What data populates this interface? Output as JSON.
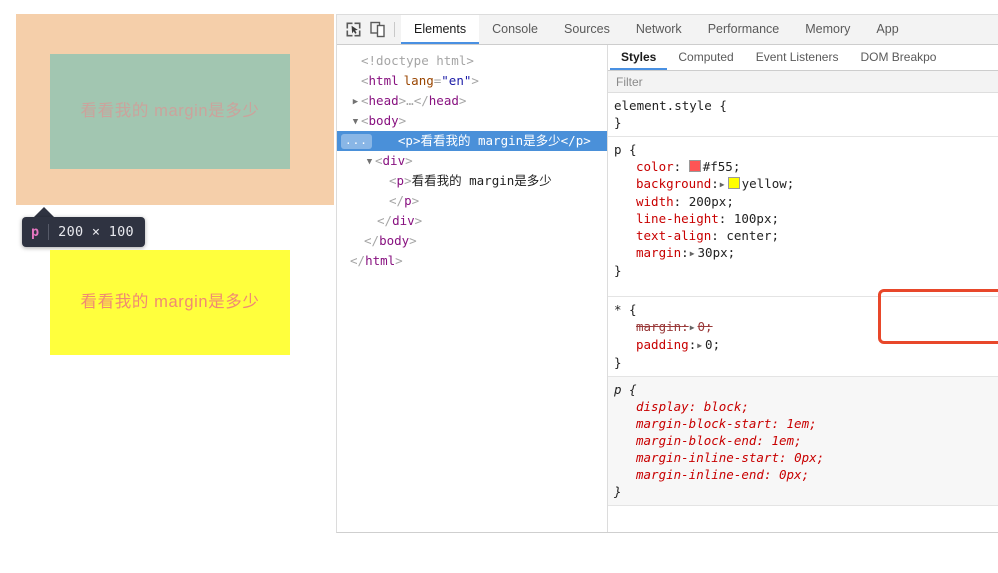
{
  "viewport": {
    "paragraph_text": "看看我的 margin是多少",
    "colors": {
      "margin_highlight": "#f5cfaa",
      "content_highlight": "#a2c6b1",
      "paragraph_background": "#ffff3d",
      "paragraph_color": "#f08a72"
    },
    "node_tooltip": {
      "tag": "p",
      "dimensions": "200 × 100"
    }
  },
  "devtools": {
    "toolbar_icons": [
      {
        "name": "inspect-element-icon"
      },
      {
        "name": "device-toolbar-icon"
      }
    ],
    "tabs": [
      {
        "label": "Elements",
        "active": true
      },
      {
        "label": "Console",
        "active": false
      },
      {
        "label": "Sources",
        "active": false
      },
      {
        "label": "Network",
        "active": false
      },
      {
        "label": "Performance",
        "active": false
      },
      {
        "label": "Memory",
        "active": false
      },
      {
        "label": "App",
        "active": false
      }
    ],
    "dom_tree": [
      {
        "indent": 0,
        "twisty": "",
        "html": "doctype",
        "selected": false
      },
      {
        "indent": 0,
        "twisty": "",
        "html": "html_open",
        "selected": false
      },
      {
        "indent": 0,
        "twisty": "▶",
        "html": "head",
        "selected": false
      },
      {
        "indent": 0,
        "twisty": "▼",
        "html": "body_open",
        "selected": false
      },
      {
        "indent": 1,
        "twisty": "",
        "html": "p_selected",
        "selected": true
      },
      {
        "indent": 1,
        "twisty": "▼",
        "html": "div_open",
        "selected": false
      },
      {
        "indent": 2,
        "twisty": "",
        "html": "p_inner",
        "selected": false
      },
      {
        "indent": 2,
        "twisty": "",
        "html": "p_close",
        "selected": false
      },
      {
        "indent": 1,
        "twisty": "",
        "html": "div_close",
        "selected": false
      },
      {
        "indent": 0,
        "twisty": "",
        "html": "body_close",
        "selected": false
      },
      {
        "indent": 0,
        "twisty": "",
        "html": "html_close",
        "selected": false
      }
    ],
    "dom_text": {
      "doctype": "<!doctype html>",
      "html_tag": "html",
      "html_attr_name": "lang",
      "html_attr_value": "\"en\"",
      "head_tag": "head",
      "head_collapsed": "…",
      "body_tag": "body",
      "p_tag": "p",
      "div_tag": "div",
      "paragraph_text": "看看我的 margin是多少",
      "ellipsis_badge": "..."
    },
    "styles_tabs": [
      {
        "label": "Styles",
        "active": true
      },
      {
        "label": "Computed",
        "active": false
      },
      {
        "label": "Event Listeners",
        "active": false
      },
      {
        "label": "DOM Breakpo",
        "active": false
      }
    ],
    "filter": {
      "placeholder": "Filter",
      "value": ""
    },
    "css_rules": [
      {
        "selector": "element.style",
        "italic": false,
        "declarations": []
      },
      {
        "selector": "p",
        "italic": false,
        "declarations": [
          {
            "property": "color",
            "value": "#f55",
            "swatch": "#f55",
            "expandable": false,
            "struck": false
          },
          {
            "property": "background",
            "value": "yellow",
            "swatch": "#ffff00",
            "expandable": true,
            "struck": false
          },
          {
            "property": "width",
            "value": "200px",
            "swatch": null,
            "expandable": false,
            "struck": false
          },
          {
            "property": "line-height",
            "value": "100px",
            "swatch": null,
            "expandable": false,
            "struck": false
          },
          {
            "property": "text-align",
            "value": "center",
            "swatch": null,
            "expandable": false,
            "struck": false
          },
          {
            "property": "margin",
            "value": "30px",
            "swatch": null,
            "expandable": true,
            "struck": false
          }
        ]
      },
      {
        "selector": "*",
        "italic": false,
        "declarations": [
          {
            "property": "margin",
            "value": "0",
            "swatch": null,
            "expandable": true,
            "struck": true
          },
          {
            "property": "padding",
            "value": "0",
            "swatch": null,
            "expandable": true,
            "struck": false
          }
        ]
      },
      {
        "selector": "p",
        "italic": true,
        "declarations": [
          {
            "property": "display",
            "value": "block",
            "swatch": null,
            "expandable": false,
            "struck": false
          },
          {
            "property": "margin-block-start",
            "value": "1em",
            "swatch": null,
            "expandable": false,
            "struck": false
          },
          {
            "property": "margin-block-end",
            "value": "1em",
            "swatch": null,
            "expandable": false,
            "struck": false
          },
          {
            "property": "margin-inline-start",
            "value": "0px",
            "swatch": null,
            "expandable": false,
            "struck": false
          },
          {
            "property": "margin-inline-end",
            "value": "0px",
            "swatch": null,
            "expandable": false,
            "struck": false
          }
        ]
      }
    ],
    "annotation": {
      "color": "#e8472a",
      "target_property": "margin"
    }
  }
}
